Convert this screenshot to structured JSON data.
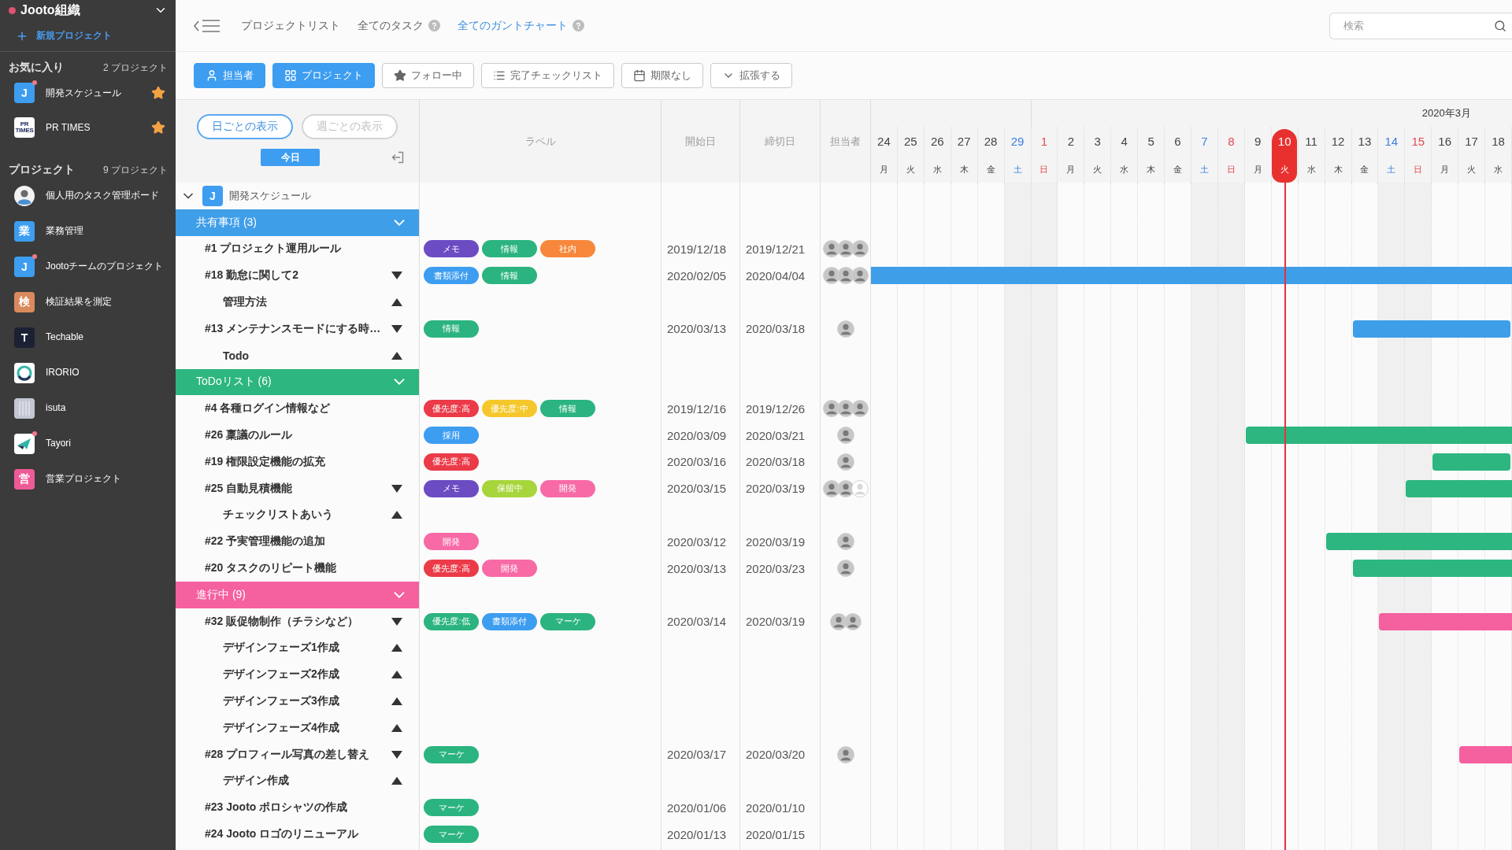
{
  "sidebar": {
    "org": "Jooto組織",
    "new_project": "新規プロジェクト",
    "sections": [
      {
        "title": "お気に入り",
        "count": "2 プロジェクト",
        "items": [
          {
            "name": "開発スケジュール",
            "icon": {
              "kind": "letter",
              "text": "J",
              "color": "#3d9df0"
            },
            "unread": true,
            "starred": true
          },
          {
            "name": "PR TIMES",
            "icon": {
              "kind": "logo-text",
              "text": "PR TIMES"
            },
            "unread": false,
            "starred": true
          }
        ]
      },
      {
        "title": "プロジェクト",
        "count": "9 プロジェクト",
        "items": [
          {
            "name": "個人用のタスク管理ボード",
            "icon": {
              "kind": "photo"
            },
            "unread": false,
            "starred": false
          },
          {
            "name": "業務管理",
            "icon": {
              "kind": "letter",
              "text": "業",
              "color": "#3d9df0"
            },
            "unread": false,
            "starred": false
          },
          {
            "name": "Jootoチームのプロジェクト",
            "icon": {
              "kind": "letter",
              "text": "J",
              "color": "#3d9df0"
            },
            "unread": true,
            "starred": false
          },
          {
            "name": "検証結果を測定",
            "icon": {
              "kind": "letter",
              "text": "検",
              "color": "#d98a5c"
            },
            "unread": false,
            "starred": false
          },
          {
            "name": "Techable",
            "icon": {
              "kind": "letter",
              "text": "T",
              "color": "#1c2033"
            },
            "unread": false,
            "starred": false
          },
          {
            "name": "IRORIO",
            "icon": {
              "kind": "ring"
            },
            "unread": false,
            "starred": false
          },
          {
            "name": "isuta",
            "icon": {
              "kind": "stripes"
            },
            "unread": false,
            "starred": false
          },
          {
            "name": "Tayori",
            "icon": {
              "kind": "plane"
            },
            "unread": true,
            "starred": false
          },
          {
            "name": "営業プロジェクト",
            "icon": {
              "kind": "letter",
              "text": "営",
              "color": "#ee5a96"
            },
            "unread": false,
            "starred": false
          }
        ]
      }
    ]
  },
  "nav": [
    {
      "label": "プロジェクトリスト",
      "help": false,
      "selected": false
    },
    {
      "label": "全てのタスク",
      "help": true,
      "selected": false
    },
    {
      "label": "全てのガントチャート",
      "help": true,
      "selected": true
    }
  ],
  "search": {
    "placeholder": "検索"
  },
  "toolbar": [
    {
      "label": "担当者",
      "kind": "person",
      "selected": true
    },
    {
      "label": "プロジェクト",
      "kind": "grid",
      "selected": true
    },
    {
      "label": "フォロー中",
      "kind": "star",
      "selected": false
    },
    {
      "label": "完了チェックリスト",
      "kind": "list",
      "selected": false
    },
    {
      "label": "期限なし",
      "kind": "calendar",
      "selected": false
    },
    {
      "label": "拡張する",
      "kind": "chevron",
      "selected": false
    }
  ],
  "view_toggle": [
    {
      "label": "日ごとの表示",
      "selected": true
    },
    {
      "label": "週ごとの表示",
      "selected": false
    }
  ],
  "today_button": "今日",
  "columns": [
    "ラベル",
    "開始日",
    "締切日",
    "担当者"
  ],
  "timeline": {
    "month": "2020年3月",
    "days": [
      {
        "day": "24",
        "weekday": "月",
        "kind": "weekday",
        "today": false
      },
      {
        "day": "25",
        "weekday": "火",
        "kind": "weekday",
        "today": false
      },
      {
        "day": "26",
        "weekday": "水",
        "kind": "weekday",
        "today": false
      },
      {
        "day": "27",
        "weekday": "木",
        "kind": "weekday",
        "today": false
      },
      {
        "day": "28",
        "weekday": "金",
        "kind": "weekday",
        "today": false
      },
      {
        "day": "29",
        "weekday": "土",
        "kind": "saturday",
        "today": false
      },
      {
        "day": "1",
        "weekday": "日",
        "kind": "sunday",
        "today": false
      },
      {
        "day": "2",
        "weekday": "月",
        "kind": "weekday",
        "today": false
      },
      {
        "day": "3",
        "weekday": "火",
        "kind": "weekday",
        "today": false
      },
      {
        "day": "4",
        "weekday": "水",
        "kind": "weekday",
        "today": false
      },
      {
        "day": "5",
        "weekday": "木",
        "kind": "weekday",
        "today": false
      },
      {
        "day": "6",
        "weekday": "金",
        "kind": "weekday",
        "today": false
      },
      {
        "day": "7",
        "weekday": "土",
        "kind": "saturday",
        "today": false
      },
      {
        "day": "8",
        "weekday": "日",
        "kind": "sunday",
        "today": false
      },
      {
        "day": "9",
        "weekday": "月",
        "kind": "weekday",
        "today": false
      },
      {
        "day": "10",
        "weekday": "火",
        "kind": "weekday",
        "today": true
      },
      {
        "day": "11",
        "weekday": "水",
        "kind": "weekday",
        "today": false
      },
      {
        "day": "12",
        "weekday": "木",
        "kind": "weekday",
        "today": false
      },
      {
        "day": "13",
        "weekday": "金",
        "kind": "weekday",
        "today": false
      },
      {
        "day": "14",
        "weekday": "土",
        "kind": "saturday",
        "today": false
      },
      {
        "day": "15",
        "weekday": "日",
        "kind": "sunday",
        "today": false
      },
      {
        "day": "16",
        "weekday": "月",
        "kind": "weekday",
        "today": false
      },
      {
        "day": "17",
        "weekday": "火",
        "kind": "weekday",
        "today": false
      },
      {
        "day": "18",
        "weekday": "水",
        "kind": "weekday",
        "today": false
      }
    ]
  },
  "project": {
    "name": "開発スケジュール",
    "icon": {
      "kind": "letter",
      "text": "J",
      "color": "#3d9df0"
    },
    "expanded": true,
    "groups": [
      {
        "name": "共有事項 (3)",
        "color": "#3f9ee8",
        "expanded": true,
        "tasks": [
          {
            "title": "#1 プロジェクト運用ルール",
            "labels": [
              {
                "text": "メモ",
                "color": "#6c4bc3"
              },
              {
                "text": "情報",
                "color": "#2bb47f"
              },
              {
                "text": "社内",
                "color": "#f7873b"
              }
            ],
            "start": "2019/12/18",
            "due": "2019/12/21",
            "assignees": [
              {
                "kind": "photo"
              },
              {
                "kind": "photo"
              },
              {
                "kind": "photo"
              }
            ]
          },
          {
            "title": "#18 勤怠に関して2",
            "labels": [
              {
                "text": "書類添付",
                "color": "#3d9df0"
              },
              {
                "text": "情報",
                "color": "#2bb47f"
              }
            ],
            "start": "2020/02/05",
            "due": "2020/04/04",
            "assignees": [
              {
                "kind": "photo"
              },
              {
                "kind": "photo"
              },
              {
                "kind": "photo"
              }
            ],
            "expanded": true,
            "children": [
              {
                "title": "管理方法"
              }
            ]
          },
          {
            "title": "#13 メンテナンスモードにする時…",
            "labels": [
              {
                "text": "情報",
                "color": "#2bb47f"
              }
            ],
            "start": "2020/03/13",
            "due": "2020/03/18",
            "assignees": [
              {
                "kind": "photo"
              }
            ],
            "expanded": true,
            "children": [
              {
                "title": "Todo"
              }
            ]
          }
        ]
      },
      {
        "name": "ToDoリスト (6)",
        "color": "#2db67f",
        "expanded": true,
        "tasks": [
          {
            "title": "#4 各種ログイン情報など",
            "labels": [
              {
                "text": "優先度:高",
                "color": "#eb3a48"
              },
              {
                "text": "優先度:中",
                "color": "#f5c72a"
              },
              {
                "text": "情報",
                "color": "#2bb47f"
              }
            ],
            "start": "2019/12/16",
            "due": "2019/12/26",
            "assignees": [
              {
                "kind": "photo"
              },
              {
                "kind": "photo"
              },
              {
                "kind": "photo"
              }
            ]
          },
          {
            "title": "#26 稟議のルール",
            "labels": [
              {
                "text": "採用",
                "color": "#3d9df0"
              }
            ],
            "start": "2020/03/09",
            "due": "2020/03/21",
            "assignees": [
              {
                "kind": "photo"
              }
            ]
          },
          {
            "title": "#19 権限設定機能の拡充",
            "labels": [
              {
                "text": "優先度:高",
                "color": "#eb3a48"
              }
            ],
            "start": "2020/03/16",
            "due": "2020/03/18",
            "assignees": [
              {
                "kind": "photo"
              }
            ]
          },
          {
            "title": "#25 自動見積機能",
            "labels": [
              {
                "text": "メモ",
                "color": "#6c4bc3"
              },
              {
                "text": "保留中",
                "color": "#a7d53c"
              },
              {
                "text": "開発",
                "color": "#f76aa6"
              }
            ],
            "start": "2020/03/15",
            "due": "2020/03/19",
            "assignees": [
              {
                "kind": "photo"
              },
              {
                "kind": "photo"
              },
              {
                "kind": "blank"
              }
            ],
            "expanded": true,
            "children": [
              {
                "title": "チェックリストあいう"
              }
            ]
          },
          {
            "title": "#22 予実管理機能の追加",
            "labels": [
              {
                "text": "開発",
                "color": "#f76aa6"
              }
            ],
            "start": "2020/03/12",
            "due": "2020/03/19",
            "assignees": [
              {
                "kind": "photo"
              }
            ]
          },
          {
            "title": "#20 タスクのリピート機能",
            "labels": [
              {
                "text": "優先度:高",
                "color": "#eb3a48"
              },
              {
                "text": "開発",
                "color": "#f76aa6"
              }
            ],
            "start": "2020/03/13",
            "due": "2020/03/23",
            "assignees": [
              {
                "kind": "photo"
              }
            ]
          }
        ]
      },
      {
        "name": "進行中 (9)",
        "color": "#f5609f",
        "expanded": true,
        "tasks": [
          {
            "title": "#32 販促物制作（チラシなど）",
            "labels": [
              {
                "text": "優先度:低",
                "color": "#2bb47f"
              },
              {
                "text": "書類添付",
                "color": "#3d9df0"
              },
              {
                "text": "マーケ",
                "color": "#2bb47f"
              }
            ],
            "start": "2020/03/14",
            "due": "2020/03/19",
            "assignees": [
              {
                "kind": "photo"
              },
              {
                "kind": "photo"
              }
            ],
            "expanded": true,
            "children": [
              {
                "title": "デザインフェーズ1作成"
              },
              {
                "title": "デザインフェーズ2作成"
              },
              {
                "title": "デザインフェーズ3作成"
              },
              {
                "title": "デザインフェーズ4作成"
              }
            ]
          },
          {
            "title": "#28 プロフィール写真の差し替え",
            "labels": [
              {
                "text": "マーケ",
                "color": "#2bb47f"
              }
            ],
            "start": "2020/03/17",
            "due": "2020/03/20",
            "assignees": [
              {
                "kind": "photo"
              }
            ],
            "expanded": true,
            "children": [
              {
                "title": "デザイン作成"
              }
            ]
          },
          {
            "title": "#23 Jooto ポロシャツの作成",
            "labels": [
              {
                "text": "マーケ",
                "color": "#2bb47f"
              }
            ],
            "start": "2020/01/06",
            "due": "2020/01/10"
          },
          {
            "title": "#24 Jooto ロゴのリニューアル",
            "labels": [
              {
                "text": "マーケ",
                "color": "#2bb47f"
              }
            ],
            "start": "2020/01/13",
            "due": "2020/01/15"
          }
        ]
      }
    ]
  }
}
